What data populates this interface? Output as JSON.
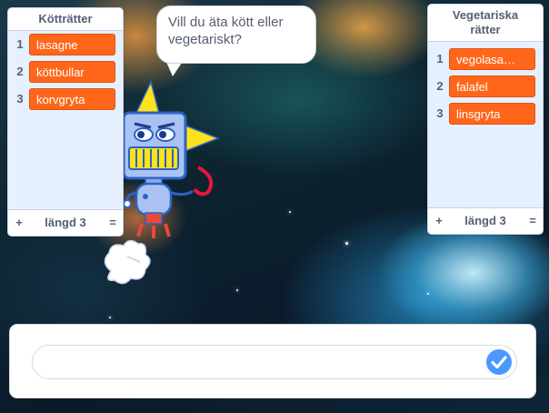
{
  "lists": {
    "meat": {
      "title": "Kötträtter",
      "items": [
        {
          "index": "1",
          "value": "lasagne"
        },
        {
          "index": "2",
          "value": "köttbullar"
        },
        {
          "index": "3",
          "value": "korvgryta"
        }
      ],
      "footer": {
        "add": "+",
        "length": "längd 3",
        "resize": "="
      }
    },
    "vegetarian": {
      "title_line1": "Vegetariska",
      "title_line2": "rätter",
      "items": [
        {
          "index": "1",
          "value": "vegolasa…"
        },
        {
          "index": "2",
          "value": "falafel"
        },
        {
          "index": "3",
          "value": "linsgryta"
        }
      ],
      "footer": {
        "add": "+",
        "length": "längd 3",
        "resize": "="
      }
    }
  },
  "speech": {
    "line1": "Vill du äta kött eller",
    "line2": "vegetariskt?"
  },
  "ask": {
    "value": ""
  },
  "colors": {
    "list_item": "#ff661a",
    "monitor_bg": "#e6f0ff",
    "text": "#575e75",
    "submit": "#4c97ff"
  },
  "icons": {
    "submit": "check-icon",
    "sprite": "robot-sprite",
    "effect": "smoke-puff"
  }
}
